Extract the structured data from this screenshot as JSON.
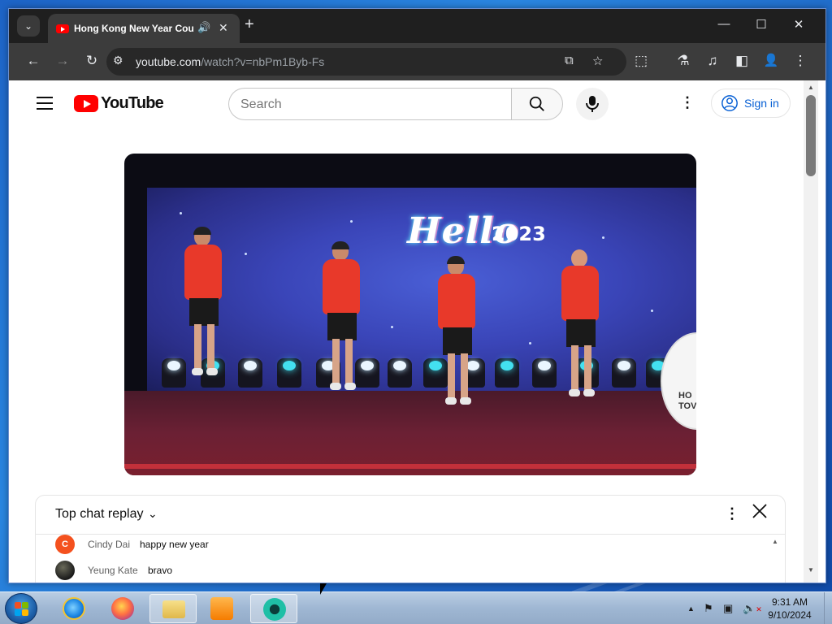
{
  "browser": {
    "tab": {
      "title": "Hong Kong New Year Countdown",
      "audio_icon": "speaker-icon",
      "close_icon": "close-icon"
    },
    "new_tab_icon": "plus-icon",
    "window_controls": {
      "minimize": "—",
      "maximize": "☐",
      "close": "✕"
    },
    "toolbar": {
      "back_icon": "←",
      "forward_icon": "→",
      "reload_icon": "↻",
      "url_host": "youtube.com",
      "url_path": "/watch?v=nbPm1Byb-Fs",
      "site_info_icon": "⚙",
      "install_icon": "⧉",
      "bookmark_icon": "☆",
      "extensions_icon": "⬚",
      "labs_icon": "⚗",
      "media_icon": "♫",
      "sidepanel_icon": "◧",
      "profile_icon": "👤",
      "menu_icon": "⋮"
    }
  },
  "youtube": {
    "logo_text": "YouTube",
    "search": {
      "placeholder": "Search",
      "value": ""
    },
    "more_icon": "⋮",
    "signin_label": "Sign in"
  },
  "video": {
    "banner_hello": "Hello",
    "banner_year": "2023",
    "side_sign": "HO\nTOV"
  },
  "chat": {
    "title": "Top chat replay",
    "caret": "⌄",
    "more_icon": "⋮",
    "close_icon": "✕",
    "messages": [
      {
        "initial": "C",
        "author": "Cindy Dai",
        "text": "happy new year",
        "avatar_color": "#f4511e"
      },
      {
        "initial": "",
        "author": "Yeung Kate",
        "text": "bravo",
        "avatar_color": "#2b2b2b"
      }
    ]
  },
  "taskbar": {
    "clock_time": "9:31 AM",
    "clock_date": "9/10/2024"
  }
}
